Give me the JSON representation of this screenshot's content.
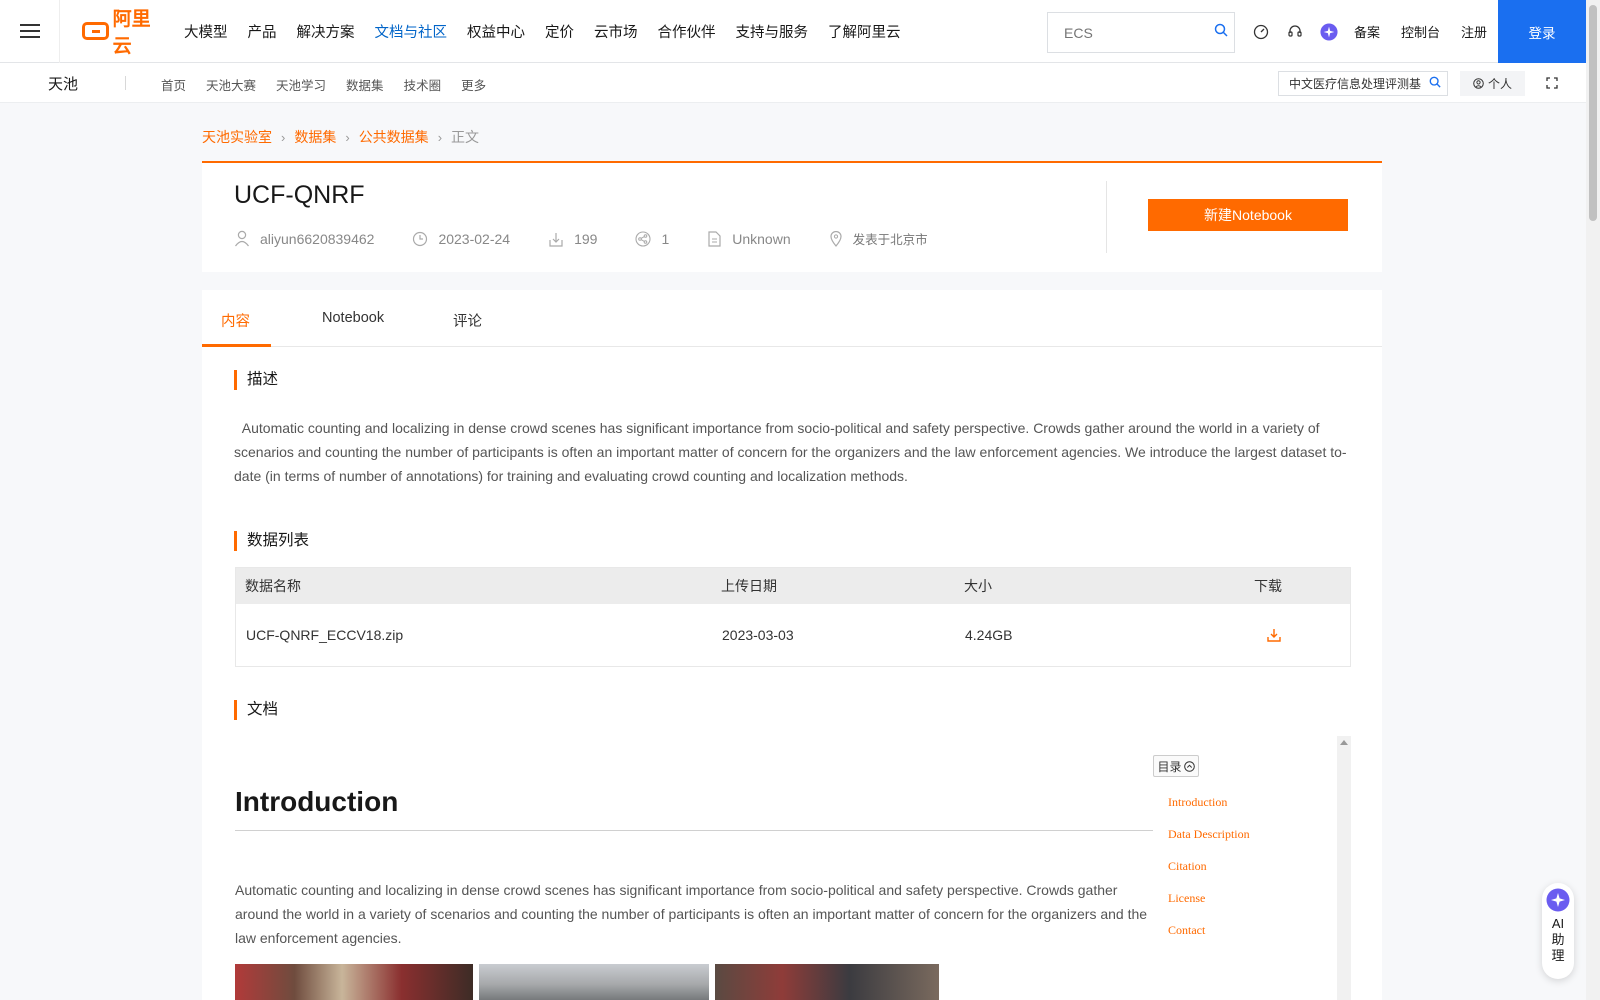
{
  "topnav": {
    "logo_text": "阿里云",
    "items": [
      "大模型",
      "产品",
      "解决方案",
      "文档与社区",
      "权益中心",
      "定价",
      "云市场",
      "合作伙伴",
      "支持与服务",
      "了解阿里云"
    ],
    "active_index": 3,
    "search_placeholder": "ECS",
    "links": [
      "备案",
      "控制台",
      "注册"
    ],
    "login_label": "登录"
  },
  "subnav": {
    "brand": "天池",
    "items": [
      "首页",
      "天池大赛",
      "天池学习",
      "数据集",
      "技术圈",
      "更多"
    ],
    "search_value": "中文医疗信息处理评测基",
    "personal_label": "个人"
  },
  "breadcrumb": {
    "items": [
      "天池实验室",
      "数据集",
      "公共数据集"
    ],
    "current": "正文"
  },
  "dataset": {
    "title": "UCF-QNRF",
    "author": "aliyun6620839462",
    "date": "2023-02-24",
    "downloads": "199",
    "shares": "1",
    "license": "Unknown",
    "location": "发表于北京市",
    "new_notebook_label": "新建Notebook"
  },
  "tabs": [
    "内容",
    "Notebook",
    "评论"
  ],
  "sections": {
    "description_title": "描述",
    "description_text": "Automatic counting and localizing in dense crowd scenes has significant importance from socio-political and safety perspective. Crowds gather around the world in a variety of scenarios and counting the number of participants is often an important matter of concern for the organizers and the law enforcement agencies. We introduce the largest dataset to-date (in terms of number of annotations) for training and evaluating crowd counting and localization methods.",
    "data_list_title": "数据列表",
    "doc_title": "文档"
  },
  "data_table": {
    "headers": [
      "数据名称",
      "上传日期",
      "大小",
      "下载"
    ],
    "rows": [
      {
        "name": "UCF-QNRF_ECCV18.zip",
        "date": "2023-03-03",
        "size": "4.24GB"
      }
    ]
  },
  "doc": {
    "heading": "Introduction",
    "paragraph": "Automatic counting and localizing in dense crowd scenes has significant importance from socio-political and safety perspective. Crowds gather around the world in a variety of scenarios and counting the number of participants is often an important matter of concern for the organizers and the law enforcement agencies.",
    "toc_label": "目录",
    "toc_items": [
      "Introduction",
      "Data Description",
      "Citation",
      "License",
      "Contact"
    ]
  },
  "ai_assistant": {
    "label": "AI助理"
  },
  "colors": {
    "accent": "#ff6a00",
    "link_blue": "#0064c8",
    "login_blue": "#1a6ff0"
  }
}
